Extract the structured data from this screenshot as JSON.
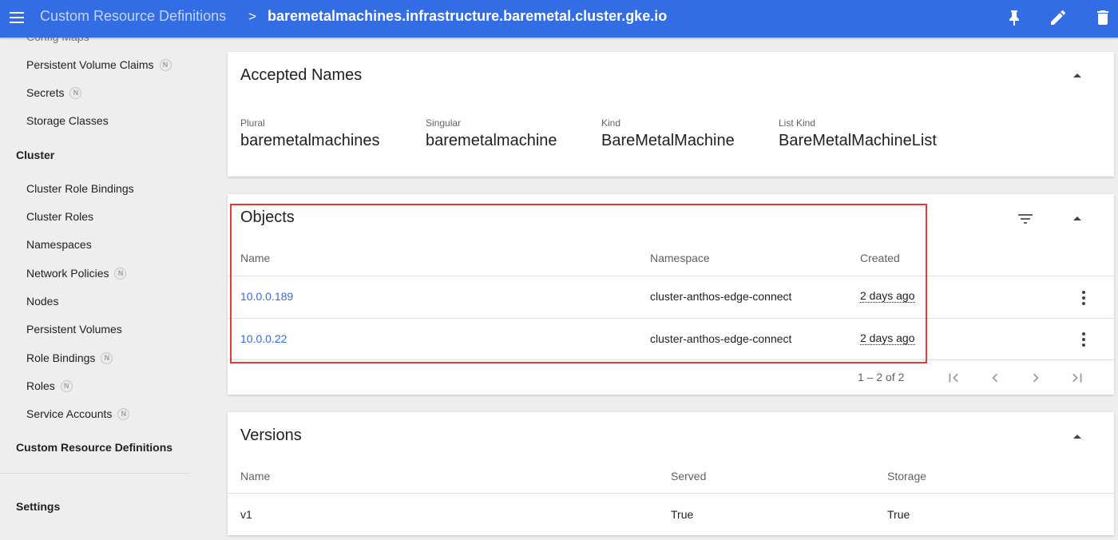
{
  "header": {
    "parent": "Custom Resource Definitions",
    "separator": ">",
    "current": "baremetalmachines.infrastructure.baremetal.cluster.gke.io",
    "actions": [
      "pin-icon",
      "edit-icon",
      "delete-icon"
    ]
  },
  "sidebar": {
    "cut_item": "Config Maps",
    "items_top": [
      {
        "label": "Persistent Volume Claims",
        "badge": "N"
      },
      {
        "label": "Secrets",
        "badge": "N"
      },
      {
        "label": "Storage Classes",
        "badge": ""
      }
    ],
    "cluster_section": "Cluster",
    "cluster_items": [
      {
        "label": "Cluster Role Bindings",
        "badge": ""
      },
      {
        "label": "Cluster Roles",
        "badge": ""
      },
      {
        "label": "Namespaces",
        "badge": ""
      },
      {
        "label": "Network Policies",
        "badge": "N"
      },
      {
        "label": "Nodes",
        "badge": ""
      },
      {
        "label": "Persistent Volumes",
        "badge": ""
      },
      {
        "label": "Role Bindings",
        "badge": "N"
      },
      {
        "label": "Roles",
        "badge": "N"
      },
      {
        "label": "Service Accounts",
        "badge": "N"
      }
    ],
    "crd_section": "Custom Resource Definitions",
    "settings_section": "Settings"
  },
  "accepted_names": {
    "title": "Accepted Names",
    "fields": [
      {
        "label": "Plural",
        "value": "baremetalmachines"
      },
      {
        "label": "Singular",
        "value": "baremetalmachine"
      },
      {
        "label": "Kind",
        "value": "BareMetalMachine"
      },
      {
        "label": "List Kind",
        "value": "BareMetalMachineList"
      }
    ]
  },
  "objects": {
    "title": "Objects",
    "columns": [
      "Name",
      "Namespace",
      "Created"
    ],
    "rows": [
      {
        "name": "10.0.0.189",
        "namespace": "cluster-anthos-edge-connect",
        "created": "2 days ago"
      },
      {
        "name": "10.0.0.22",
        "namespace": "cluster-anthos-edge-connect",
        "created": "2 days ago"
      }
    ],
    "pagination": "1 – 2 of 2"
  },
  "versions": {
    "title": "Versions",
    "columns": [
      "Name",
      "Served",
      "Storage"
    ],
    "rows": [
      {
        "name": "v1",
        "served": "True",
        "storage": "True"
      }
    ]
  },
  "colors": {
    "topbar": "#326de6",
    "link": "#326de6",
    "highlight": "#e53935"
  }
}
